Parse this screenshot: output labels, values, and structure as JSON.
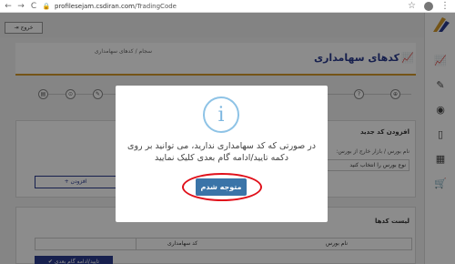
{
  "browser": {
    "back": "←",
    "forward": "→",
    "reload": "C",
    "url_host": "profilesejam.csdiran.com",
    "url_path": "/TradingCode"
  },
  "topbar": {
    "logout_label": "خروج",
    "logout_icon": "exit-icon"
  },
  "sidebar": {
    "icons": [
      "chart-icon",
      "edit-icon",
      "eye-icon",
      "mobile-icon",
      "calculator-icon",
      "cart-icon"
    ]
  },
  "header": {
    "title": "کدهای سهامداری",
    "breadcrumb_root": "سجام",
    "breadcrumb_sep": "/",
    "breadcrumb_current": "کدهای سهامداری"
  },
  "steps": [
    "⊕",
    "?",
    "⊞",
    "▭",
    "✎",
    "⊙",
    "▤"
  ],
  "add_section": {
    "title": "افزودن کد جدید",
    "field_label": "نام بورس / بازار خارج از بورس:",
    "select_value": "نوع بورس را انتخاب کنید",
    "add_button": "+ افزودن"
  },
  "list_section": {
    "title": "لیست کدها",
    "columns": [
      "نام بورس",
      "کد سهامداری"
    ],
    "confirm_button": "✔ تایید/ادامه گام بعدی"
  },
  "modal": {
    "icon": "info-icon",
    "icon_glyph": "i",
    "message": "در صورتی که کد سهامداری ندارید، می توانید بر روی دکمه تایید/ادامه گام بعدی کلیک نمایید",
    "ok_button": "متوجه شدم"
  },
  "colors": {
    "primary": "#2a3b8f",
    "modal_button": "#3a74a8",
    "highlight_ring": "#e0101a",
    "accent": "#d39a2a"
  }
}
